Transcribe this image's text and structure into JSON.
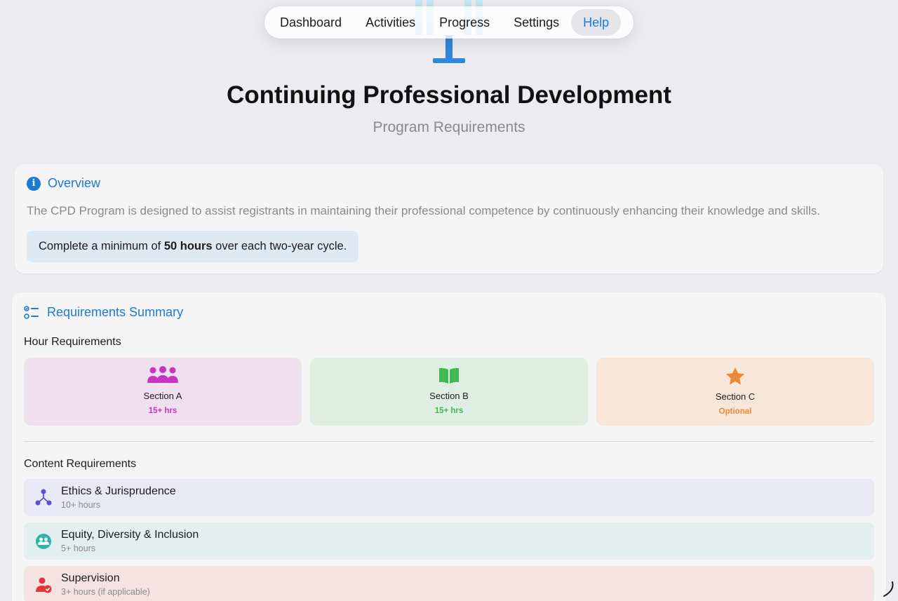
{
  "nav": {
    "items": [
      {
        "label": "Dashboard",
        "active": false
      },
      {
        "label": "Activities",
        "active": false
      },
      {
        "label": "Progress",
        "active": false
      },
      {
        "label": "Settings",
        "active": false
      },
      {
        "label": "Help",
        "active": true
      }
    ]
  },
  "header": {
    "title": "Continuing Professional Development",
    "subtitle": "Program Requirements"
  },
  "overview": {
    "heading": "Overview",
    "icon": "info-icon",
    "text": "The CPD Program is designed to assist registrants in maintaining their professional competence by continuously enhancing their knowledge and skills.",
    "callout_prefix": "Complete a minimum of ",
    "callout_bold": "50 hours",
    "callout_suffix": " over each two-year cycle."
  },
  "requirements": {
    "heading": "Requirements Summary",
    "icon": "checklist-icon",
    "hour_heading": "Hour Requirements",
    "sections": [
      {
        "name": "Section A",
        "value": "15+ hrs",
        "icon": "people-icon",
        "color": "#c735c4"
      },
      {
        "name": "Section B",
        "value": "15+ hrs",
        "icon": "book-icon",
        "color": "#3fb950"
      },
      {
        "name": "Section C",
        "value": "Optional",
        "icon": "star-icon",
        "color": "#ea8a35"
      }
    ],
    "content_heading": "Content Requirements",
    "content": [
      {
        "title": "Ethics & Jurisprudence",
        "sub": "10+ hours",
        "icon": "nodes-icon",
        "color": "#5b4fd6",
        "bg": "#e9e9f5"
      },
      {
        "title": "Equity, Diversity & Inclusion",
        "sub": "5+ hours",
        "icon": "group-circle-icon",
        "color": "#2fb3a8",
        "bg": "#e3efee"
      },
      {
        "title": "Supervision",
        "sub": "3+ hours (if applicable)",
        "icon": "person-check-icon",
        "color": "#e0373c",
        "bg": "#f5e3e3"
      }
    ]
  },
  "colors": {
    "accent": "#1c7ad8",
    "background": "#ebebf0",
    "card": "#f5f5f5",
    "muted_text": "#8a8a8e"
  }
}
